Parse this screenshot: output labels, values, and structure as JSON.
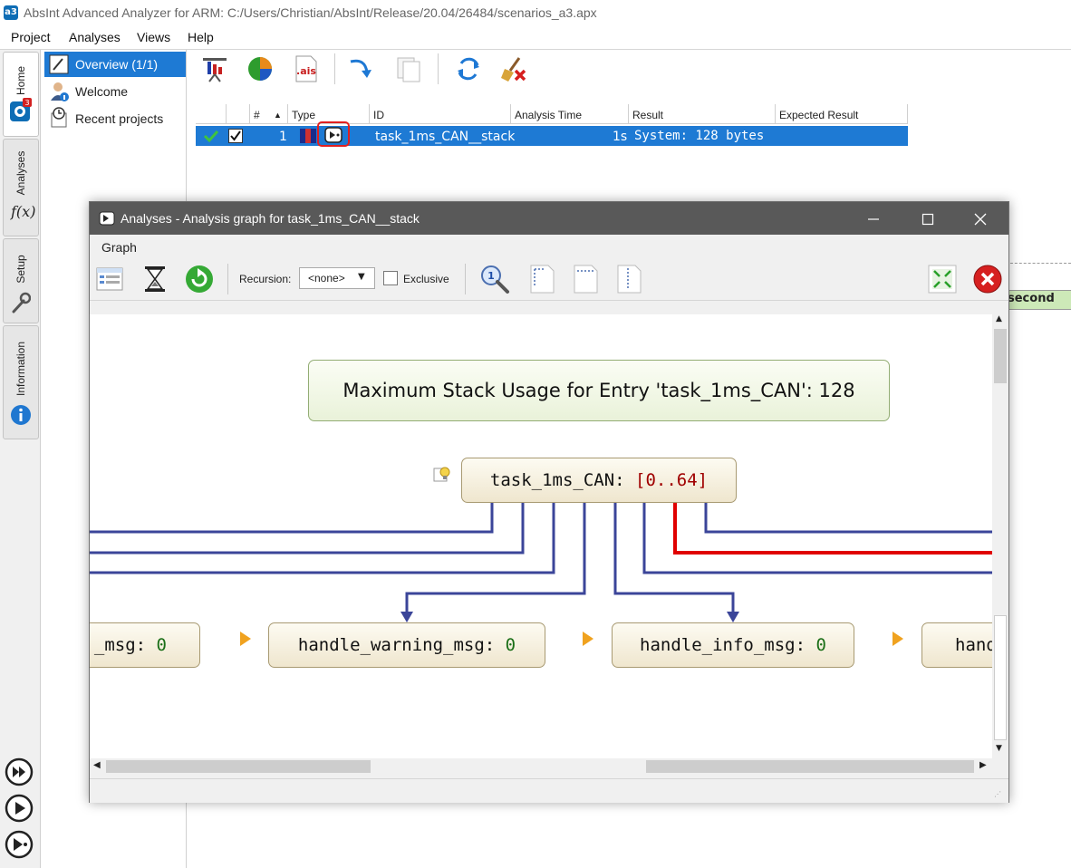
{
  "window": {
    "title": "AbsInt Advanced Analyzer for ARM: C:/Users/Christian/AbsInt/Release/20.04/26484/scenarios_a3.apx",
    "app_icon_text": "a3"
  },
  "menubar": [
    "Project",
    "Analyses",
    "Views",
    "Help"
  ],
  "vtabs": [
    "Home",
    "Analyses",
    "Setup",
    "Information"
  ],
  "vtab_fx": "f(x)",
  "nav": {
    "items": [
      {
        "label": "Overview (1/1)",
        "selected": true
      },
      {
        "label": "Welcome",
        "selected": false
      },
      {
        "label": "Recent projects",
        "selected": false
      }
    ]
  },
  "table": {
    "headers": [
      "#",
      "Type",
      "ID",
      "Analysis Time",
      "Result",
      "Expected Result"
    ],
    "rows": [
      {
        "index": "1",
        "id": "task_1ms_CAN__stack",
        "time": "1s",
        "result": "System: 128 bytes",
        "expected": ""
      }
    ]
  },
  "right_strip_label": "second",
  "dialog": {
    "title": "Analyses - Analysis graph for task_1ms_CAN__stack",
    "menu": "Graph",
    "recursion_label": "Recursion:",
    "recursion_value": "<none>",
    "exclusive_label": "Exclusive",
    "summary": "Maximum Stack Usage for Entry 'task_1ms_CAN': 128",
    "root_node": {
      "name": "task_1ms_CAN: ",
      "value": "[0..64]"
    },
    "child_nodes": [
      {
        "name": "_msg: ",
        "value": "0"
      },
      {
        "name": "handle_warning_msg: ",
        "value": "0"
      },
      {
        "name": "handle_info_msg: ",
        "value": "0"
      },
      {
        "name": "hand",
        "value": ""
      }
    ]
  },
  "colors": {
    "accent": "#1e7ad4",
    "edge": "#3b4599",
    "edge_critical": "#e00000",
    "node_border": "#a89a72",
    "arrow": "#f0a21f"
  }
}
